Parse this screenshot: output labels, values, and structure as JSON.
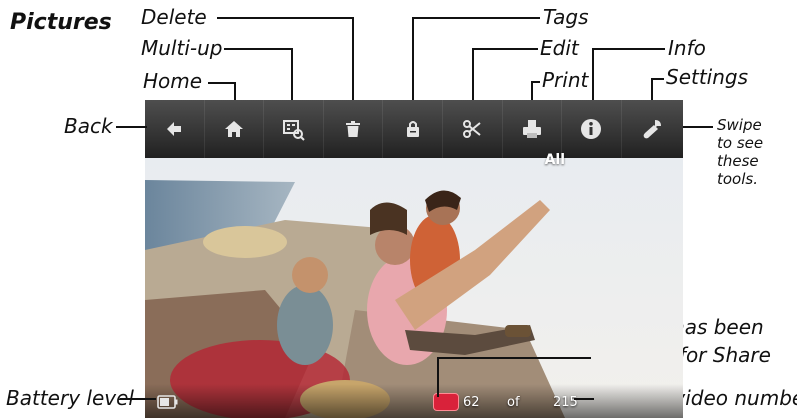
{
  "title": "Pictures",
  "callouts": {
    "delete": "Delete",
    "multi_up": "Multi-up",
    "home": "Home",
    "back": "Back",
    "tags": "Tags",
    "edit": "Edit",
    "print": "Print",
    "info": "Info",
    "settings": "Settings",
    "swipe": [
      "Swipe",
      "to see",
      "these",
      "tools."
    ],
    "share_marked": [
      "Picture has been",
      "marked for Share"
    ],
    "battery": "Battery level",
    "picture_number": "Picture/video number"
  },
  "toolbar": {
    "icons": [
      "back-arrow-icon",
      "home-icon",
      "multi-up-icon",
      "trash-icon",
      "tag-icon",
      "scissors-icon",
      "printer-icon",
      "info-icon",
      "wrench-icon"
    ]
  },
  "screen": {
    "filter_label": "All",
    "current": "62",
    "of_label": "of",
    "total": "215"
  },
  "colors": {
    "toolbar": "#353535",
    "share_badge": "#d9223a",
    "icon": "#e6e6e6"
  }
}
